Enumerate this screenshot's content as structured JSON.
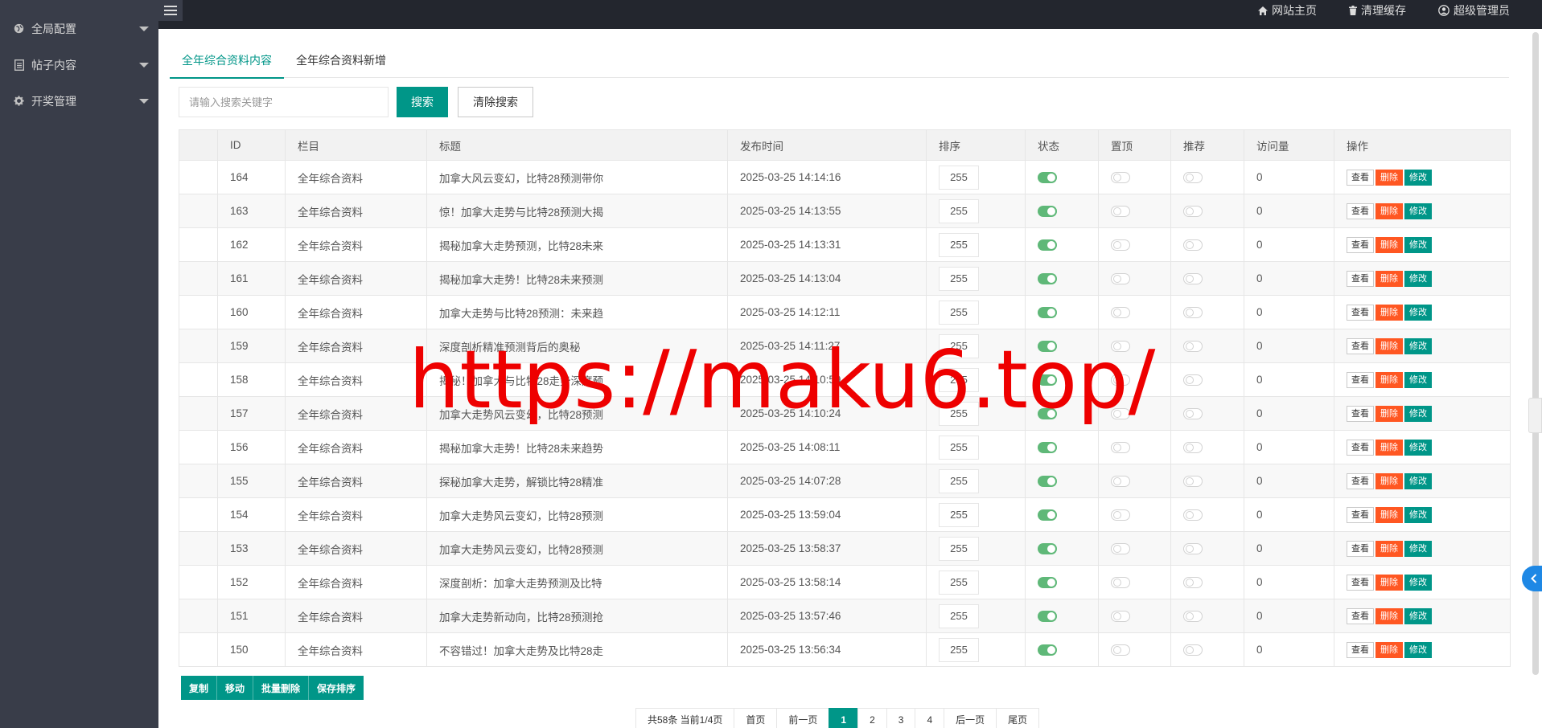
{
  "sidebar": {
    "items": [
      {
        "label": "全局配置",
        "icon": "globe-icon"
      },
      {
        "label": "帖子内容",
        "icon": "document-icon"
      },
      {
        "label": "开奖管理",
        "icon": "gear-icon"
      }
    ]
  },
  "topbar": {
    "links": [
      {
        "label": "网站主页",
        "icon": "home-icon"
      },
      {
        "label": "清理缓存",
        "icon": "trash-icon"
      },
      {
        "label": "超级管理员",
        "icon": "user-icon"
      }
    ]
  },
  "tabs": [
    {
      "label": "全年综合资料内容",
      "active": true
    },
    {
      "label": "全年综合资料新增",
      "active": false
    }
  ],
  "search": {
    "placeholder": "请输入搜索关键字",
    "search_label": "搜索",
    "clear_label": "清除搜索"
  },
  "table": {
    "headers": [
      "",
      "ID",
      "栏目",
      "标题",
      "发布时间",
      "排序",
      "状态",
      "置顶",
      "推荐",
      "访问量",
      "操作"
    ],
    "rows": [
      {
        "id": "164",
        "category": "全年综合资料",
        "title": "加拿大风云变幻，比特28预测带你",
        "time": "2025-03-25 14:14:16",
        "sort": "255",
        "status": true,
        "top": false,
        "recommend": false,
        "views": "0"
      },
      {
        "id": "163",
        "category": "全年综合资料",
        "title": "惊！加拿大走势与比特28预测大揭",
        "time": "2025-03-25 14:13:55",
        "sort": "255",
        "status": true,
        "top": false,
        "recommend": false,
        "views": "0"
      },
      {
        "id": "162",
        "category": "全年综合资料",
        "title": "揭秘加拿大走势预测，比特28未来",
        "time": "2025-03-25 14:13:31",
        "sort": "255",
        "status": true,
        "top": false,
        "recommend": false,
        "views": "0"
      },
      {
        "id": "161",
        "category": "全年综合资料",
        "title": "揭秘加拿大走势！比特28未来预测",
        "time": "2025-03-25 14:13:04",
        "sort": "255",
        "status": true,
        "top": false,
        "recommend": false,
        "views": "0"
      },
      {
        "id": "160",
        "category": "全年综合资料",
        "title": "加拿大走势与比特28预测：未来趋",
        "time": "2025-03-25 14:12:11",
        "sort": "255",
        "status": true,
        "top": false,
        "recommend": false,
        "views": "0"
      },
      {
        "id": "159",
        "category": "全年综合资料",
        "title": "深度剖析精准预测背后的奥秘",
        "time": "2025-03-25 14:11:27",
        "sort": "255",
        "status": true,
        "top": false,
        "recommend": false,
        "views": "0"
      },
      {
        "id": "158",
        "category": "全年综合资料",
        "title": "揭秘！加拿大与比特28走势深度预",
        "time": "2025-03-25 14:10:59",
        "sort": "255",
        "status": true,
        "top": false,
        "recommend": false,
        "views": "0"
      },
      {
        "id": "157",
        "category": "全年综合资料",
        "title": "加拿大走势风云变幻，比特28预测",
        "time": "2025-03-25 14:10:24",
        "sort": "255",
        "status": true,
        "top": false,
        "recommend": false,
        "views": "0"
      },
      {
        "id": "156",
        "category": "全年综合资料",
        "title": "揭秘加拿大走势！比特28未来趋势",
        "time": "2025-03-25 14:08:11",
        "sort": "255",
        "status": true,
        "top": false,
        "recommend": false,
        "views": "0"
      },
      {
        "id": "155",
        "category": "全年综合资料",
        "title": "探秘加拿大走势，解锁比特28精准",
        "time": "2025-03-25 14:07:28",
        "sort": "255",
        "status": true,
        "top": false,
        "recommend": false,
        "views": "0"
      },
      {
        "id": "154",
        "category": "全年综合资料",
        "title": "加拿大走势风云变幻，比特28预测",
        "time": "2025-03-25 13:59:04",
        "sort": "255",
        "status": true,
        "top": false,
        "recommend": false,
        "views": "0"
      },
      {
        "id": "153",
        "category": "全年综合资料",
        "title": "加拿大走势风云变幻，比特28预测",
        "time": "2025-03-25 13:58:37",
        "sort": "255",
        "status": true,
        "top": false,
        "recommend": false,
        "views": "0"
      },
      {
        "id": "152",
        "category": "全年综合资料",
        "title": "深度剖析：加拿大走势预测及比特",
        "time": "2025-03-25 13:58:14",
        "sort": "255",
        "status": true,
        "top": false,
        "recommend": false,
        "views": "0"
      },
      {
        "id": "151",
        "category": "全年综合资料",
        "title": "加拿大走势新动向，比特28预测抢",
        "time": "2025-03-25 13:57:46",
        "sort": "255",
        "status": true,
        "top": false,
        "recommend": false,
        "views": "0"
      },
      {
        "id": "150",
        "category": "全年综合资料",
        "title": "不容错过！加拿大走势及比特28走",
        "time": "2025-03-25 13:56:34",
        "sort": "255",
        "status": true,
        "top": false,
        "recommend": false,
        "views": "0"
      }
    ],
    "actions": {
      "view": "查看",
      "delete": "删除",
      "edit": "修改"
    }
  },
  "bulk_actions": [
    "复制",
    "移动",
    "批量删除",
    "保存排序"
  ],
  "pagination": {
    "info": "共58条 当前1/4页",
    "first": "首页",
    "prev": "前一页",
    "pages": [
      "1",
      "2",
      "3",
      "4"
    ],
    "current": "1",
    "next": "后一页",
    "last": "尾页"
  },
  "watermark": "https://maku6.top/",
  "colors": {
    "primary": "#009688",
    "danger": "#ff5722",
    "sidebar": "#393d49",
    "topbar": "#23262e",
    "switch_on": "#5fb878"
  }
}
